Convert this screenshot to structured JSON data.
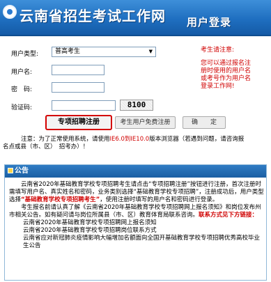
{
  "header": {
    "site_title": "云南省招生考试工作网",
    "page_title": "用户登录"
  },
  "form": {
    "user_type_label": "用户类型:",
    "user_type_value": "普高考生",
    "username_label": "用户名:",
    "password_label": "密　码:",
    "captcha_label": "验证码:",
    "captcha_code": "8100",
    "buttons": {
      "special_register": "专项招聘注册",
      "free_register": "考生用户免费注册",
      "confirm": "确　　定"
    }
  },
  "side_note": {
    "title": "考生请注意:",
    "body": "您可以通过报名注册时使用的用户名或考号作为用户名登录工作网!"
  },
  "browser_note": {
    "prefix": "注意：为了正常使用系统，请使用",
    "highlight": "IE6.0到IE10.0",
    "suffix": "版本浏览器（若遇到问题，请咨询报",
    "line2": "名点或县（市、区）　招考办）！"
  },
  "notice": {
    "heading": "公告",
    "paragraph1": "云南省2020年基础教育学校专项招聘考生请点击“专项招聘注册”按钮进行注册，首次注册时需填写用户名、真实姓名和密码，业务类别选择“基础教育学校专项招聘”，注册成功后，用户类型选择",
    "paragraph1_highlight": "“基础教育学校专项招聘考生”",
    "paragraph1_end": "，使用注册时填写的用户名和密码进行登录。",
    "paragraph2": "考生报名前请认真了解《云南省2020年基础教育学校专项招聘网上报名须知》和岗位发布州市相关公告。如有疑问请与岗位所属县（市、区）教育体育局联系咨询。",
    "contacts_title": "联系方式见下方链接：",
    "links": [
      "云南省2020年基础教育学校专项招聘网上报名须知",
      "云南省2020年基础教育学校专项招聘岗位联系方式",
      "云南省应对新冠肺炎疫情影响大幅增加名额面向全国开基础教育学校专项招聘优秀高校毕业生公告"
    ]
  }
}
